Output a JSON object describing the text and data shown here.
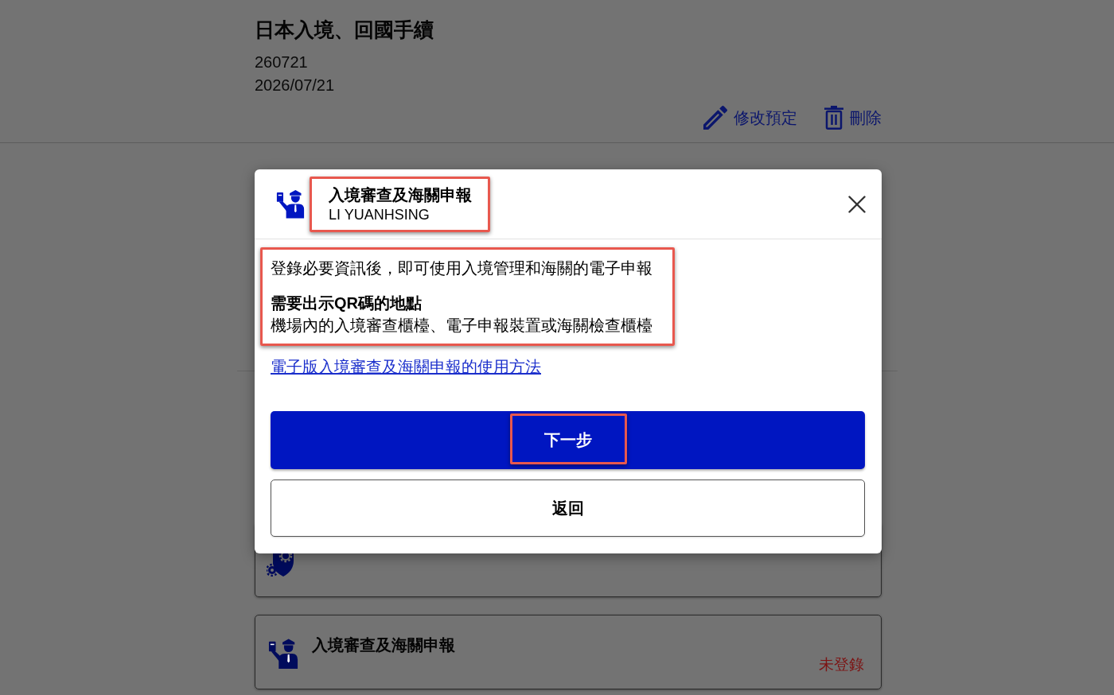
{
  "page": {
    "title": "日本入境、回國手續",
    "lines": [
      "260721",
      "2026/07/21"
    ],
    "actions": [
      {
        "kind": "edit",
        "label": "修改預定"
      },
      {
        "kind": "delete",
        "label": "刪除"
      }
    ]
  },
  "cards": [
    {
      "kind": "gears"
    },
    {
      "kind": "officer",
      "title": "入境審查及海關申報",
      "status": "未登錄"
    }
  ],
  "modal": {
    "header": {
      "title": "入境審查及海關申報",
      "name": "LI YUANHSING",
      "highlighted": true
    },
    "info": {
      "highlighted": true,
      "lines": [
        {
          "kind": "plain",
          "text": "登錄必要資訊後，即可使用入境管理和海關的電子申報"
        },
        {
          "kind": "heading",
          "text": "需要出示QR碼的地點"
        },
        {
          "kind": "plain",
          "text": "機場內的入境審查櫃檯、電子申報裝置或海關檢查櫃檯"
        }
      ]
    },
    "link": "電子版入境審查及海關申報的使用方法",
    "buttons": [
      {
        "kind": "primary",
        "label": "下一步",
        "highlighted": true
      },
      {
        "kind": "secondary",
        "label": "返回",
        "highlighted": false
      }
    ]
  }
}
